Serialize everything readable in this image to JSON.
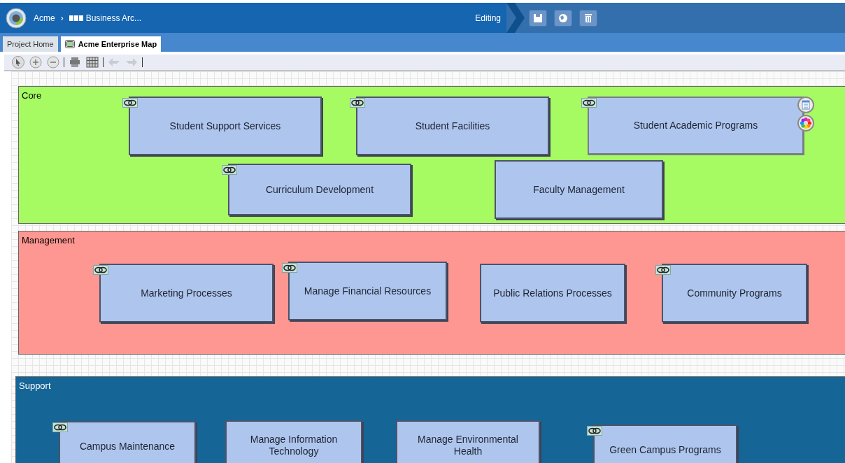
{
  "header": {
    "breadcrumb": [
      "Acme",
      "Business Arc..."
    ],
    "separator": "›",
    "mode": "Editing"
  },
  "tabs": [
    {
      "label": "Project Home",
      "selected": false
    },
    {
      "label": "Acme Enterprise Map",
      "selected": true
    }
  ],
  "lanes": [
    {
      "title": "Core",
      "color": "#a6fb63",
      "dark": false,
      "nodes": [
        {
          "label": "Student Support Services",
          "linked": true,
          "selected": false
        },
        {
          "label": "Student Facilities",
          "linked": true,
          "selected": false
        },
        {
          "label": "Student Academic Programs",
          "linked": true,
          "selected": true
        },
        {
          "label": "Curriculum Development",
          "linked": true,
          "selected": false
        },
        {
          "label": "Faculty Management",
          "linked": false,
          "selected": false
        }
      ]
    },
    {
      "title": "Management",
      "color": "#fe9791",
      "dark": false,
      "nodes": [
        {
          "label": "Marketing Processes",
          "linked": true,
          "selected": false
        },
        {
          "label": "Manage Financial Resources",
          "linked": true,
          "selected": false
        },
        {
          "label": "Public Relations Processes",
          "linked": false,
          "selected": false
        },
        {
          "label": "Community Programs",
          "linked": true,
          "selected": false
        }
      ]
    },
    {
      "title": "Support",
      "color": "#156597",
      "dark": true,
      "nodes": [
        {
          "label": "Campus Maintenance",
          "linked": true,
          "selected": false
        },
        {
          "label": "Manage Information Technology",
          "linked": false,
          "selected": false
        },
        {
          "label": "Manage Environmental Health",
          "linked": false,
          "selected": false
        },
        {
          "label": "Green Campus Programs",
          "linked": true,
          "selected": false
        }
      ]
    }
  ]
}
